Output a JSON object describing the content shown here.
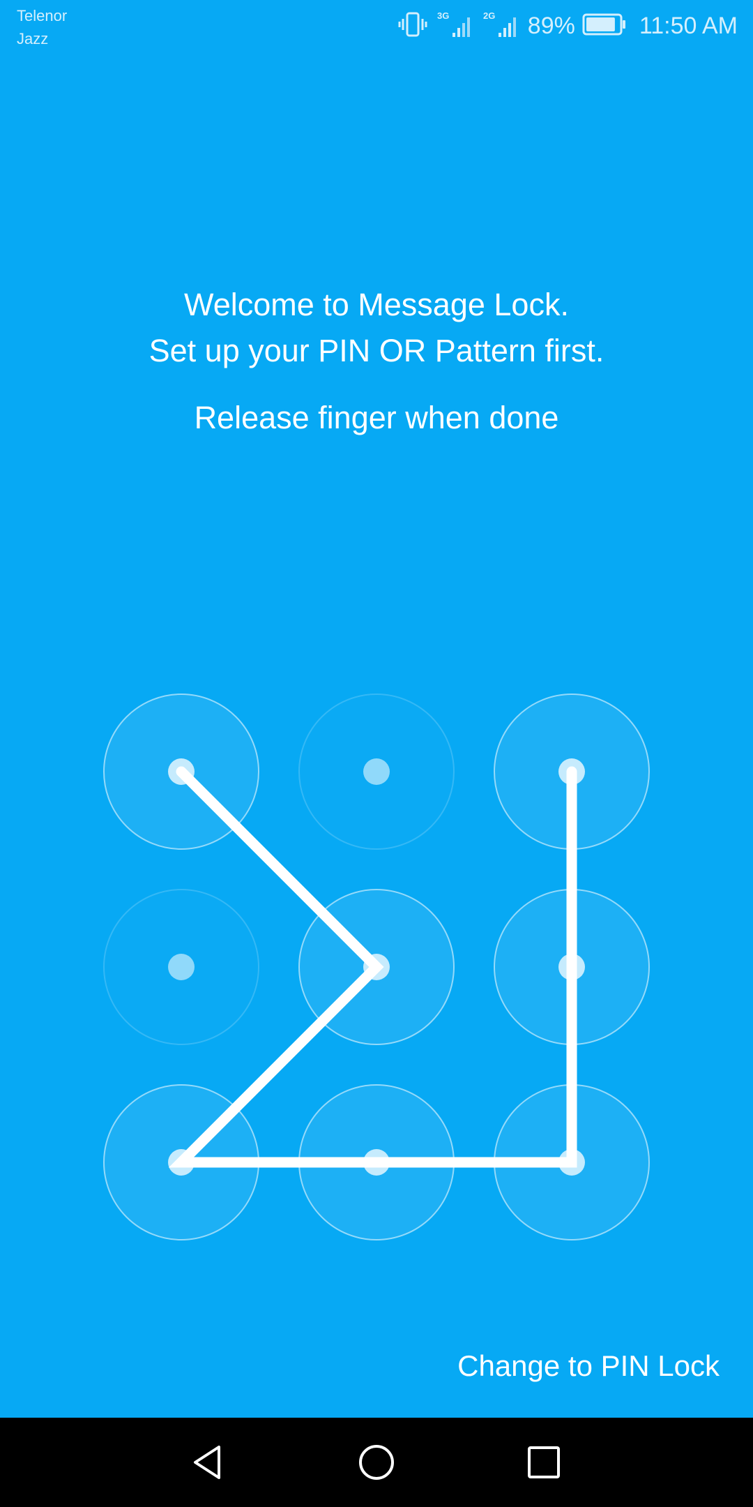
{
  "status_bar": {
    "carrier_primary": "Telenor",
    "carrier_secondary": "Jazz",
    "signal_1_label": "3G",
    "signal_2_label": "2G",
    "battery_percent": "89%",
    "battery_level": 0.89,
    "time": "11:50 AM",
    "icons": [
      "vibrate-icon",
      "signal-3g-icon",
      "signal-2g-icon",
      "battery-icon"
    ]
  },
  "prompt": {
    "line1": "Welcome to Message Lock.",
    "line2": "Set up your PIN OR Pattern first.",
    "instruction": "Release finger when done"
  },
  "pattern": {
    "nodes": [
      {
        "id": 1,
        "row": 1,
        "col": 1,
        "active": true
      },
      {
        "id": 2,
        "row": 1,
        "col": 2,
        "active": false
      },
      {
        "id": 3,
        "row": 1,
        "col": 3,
        "active": true
      },
      {
        "id": 4,
        "row": 2,
        "col": 1,
        "active": false
      },
      {
        "id": 5,
        "row": 2,
        "col": 2,
        "active": true
      },
      {
        "id": 6,
        "row": 2,
        "col": 3,
        "active": true
      },
      {
        "id": 7,
        "row": 3,
        "col": 1,
        "active": true
      },
      {
        "id": 8,
        "row": 3,
        "col": 2,
        "active": true
      },
      {
        "id": 9,
        "row": 3,
        "col": 3,
        "active": true
      }
    ],
    "sequence": [
      1,
      5,
      7,
      8,
      9,
      6,
      3
    ]
  },
  "footer": {
    "change_link": "Change to PIN Lock"
  },
  "navigation": {
    "icons": [
      "back-icon",
      "home-icon",
      "recents-icon"
    ]
  },
  "colors": {
    "background": "#07a9f4",
    "pattern_line": "#ffffff",
    "nav_bar": "#000000"
  }
}
